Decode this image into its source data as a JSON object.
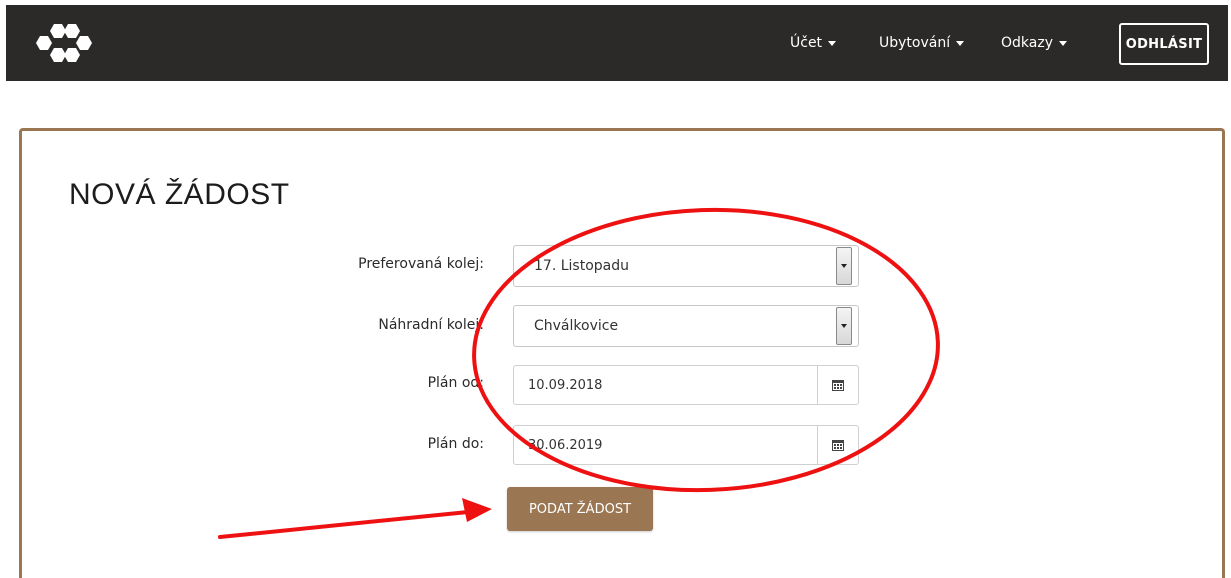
{
  "navbar": {
    "logo_icon": "hexagon-cluster-logo",
    "menu": [
      {
        "label": "Účet",
        "icon": "caret-down-icon"
      },
      {
        "label": "Ubytování",
        "icon": "caret-down-icon"
      },
      {
        "label": "Odkazy",
        "icon": "caret-down-icon"
      }
    ],
    "logout_label": "ODHLÁSIT"
  },
  "form": {
    "title": "NOVÁ ŽÁDOST",
    "preferred_dorm": {
      "label": "Preferovaná kolej:",
      "value": "17. Listopadu"
    },
    "backup_dorm": {
      "label": "Náhradní kolej:",
      "value": "Chválkovice"
    },
    "plan_from": {
      "label": "Plán od:",
      "value": "10.09.2018",
      "icon": "calendar-icon"
    },
    "plan_to": {
      "label": "Plán do:",
      "value": "30.06.2019",
      "icon": "calendar-icon"
    },
    "submit_label": "PODAT ŽÁDOST"
  },
  "colors": {
    "navbar_bg": "#2b2a28",
    "accent_brown": "#9a7652",
    "annotation_red": "#ee1111"
  }
}
